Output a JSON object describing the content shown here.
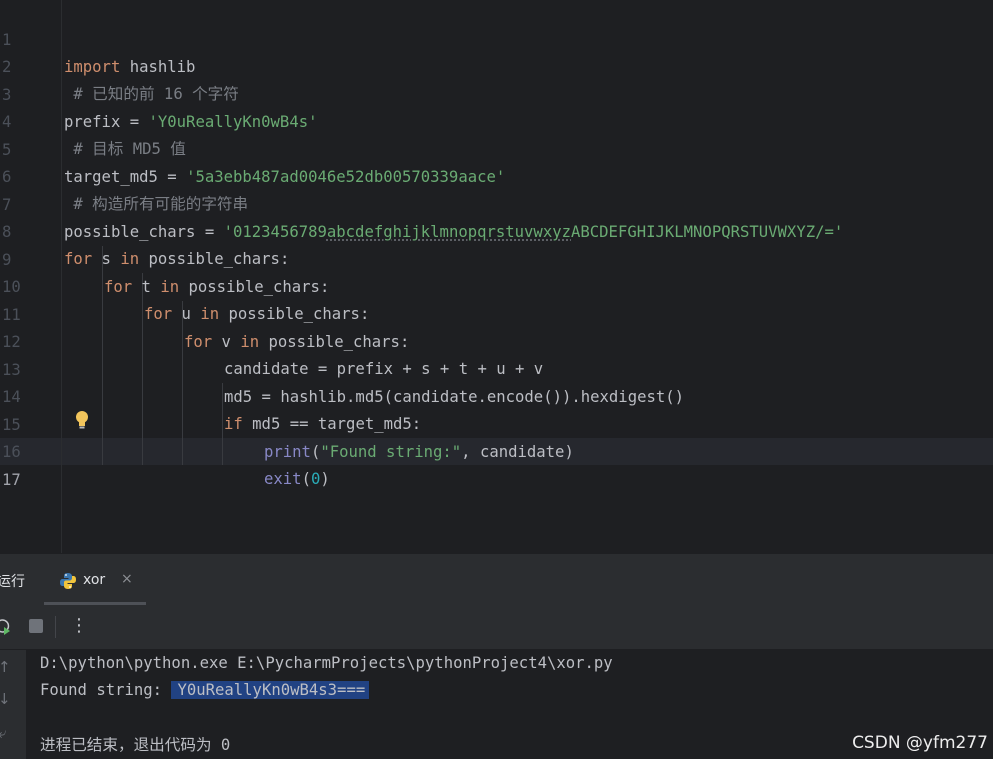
{
  "editor": {
    "line_numbers": [
      "1",
      "2",
      "3",
      "4",
      "5",
      "6",
      "7",
      "8",
      "9",
      "10",
      "11",
      "12",
      "13",
      "14",
      "15",
      "16",
      "17"
    ],
    "current_line": 17,
    "code": {
      "l1": {
        "kw": "import",
        "rest": " hashlib"
      },
      "l2": {
        "comment": " # 已知的前 16 个字符"
      },
      "l3": {
        "name": "prefix = ",
        "str": "'Y0uReallyKn0wB4s'"
      },
      "l4": {
        "comment": " # 目标 MD5 值"
      },
      "l5": {
        "name": "target_md5 = ",
        "str": "'5a3ebb487ad0046e52db00570339aace'"
      },
      "l6": {
        "comment": " # 构造所有可能的字符串"
      },
      "l7": {
        "name": "possible_chars = ",
        "str_a": "'0123456789",
        "str_b": "abcdefghijklmnopqrstuvwxyz",
        "str_c": "ABCDEFGHIJKLMNOPQRSTUVWXYZ/='"
      },
      "l8": {
        "kw1": "for",
        "mid": " s ",
        "kw2": "in",
        "rest": " possible_chars:"
      },
      "l9": {
        "kw1": "for",
        "mid": " t ",
        "kw2": "in",
        "rest": " possible_chars:"
      },
      "l10": {
        "kw1": "for",
        "mid": " u ",
        "kw2": "in",
        "rest": " possible_chars:"
      },
      "l11": {
        "kw1": "for",
        "mid": " v ",
        "kw2": "in",
        "rest": " possible_chars:"
      },
      "l12": {
        "text": "candidate = prefix + s + t + u + v"
      },
      "l13": {
        "text": "md5 = hashlib.md5(candidate.encode()).hexdigest()"
      },
      "l14": {
        "kw": "if",
        "rest": " md5 == target_md5:"
      },
      "l15": {
        "fn": "print",
        "p1": "(",
        "str": "\"Found string:\"",
        "rest": ", candidate)"
      },
      "l16": {
        "fn": "exit",
        "p1": "(",
        "num": "0",
        "rest": ")"
      }
    }
  },
  "run_panel": {
    "title": "运行",
    "tab_label": "xor",
    "tab_close": "×",
    "more": "⋮",
    "console": {
      "command": "D:\\python\\python.exe E:\\PycharmProjects\\pythonProject4\\xor.py",
      "found_label": "Found string:",
      "found_value": "Y0uReallyKn0wB4s3===",
      "exit_message": "进程已结束，退出代码为 0"
    },
    "gutter_icons": [
      "↑",
      "↓",
      "⤶"
    ]
  },
  "watermark": "CSDN @yfm277",
  "colors": {
    "keyword": "#cf8e6d",
    "string": "#6aab73",
    "comment": "#7a7e85",
    "number": "#2aacb8",
    "builtin": "#8888c6",
    "text": "#bcbec4",
    "selection": "#214283"
  }
}
